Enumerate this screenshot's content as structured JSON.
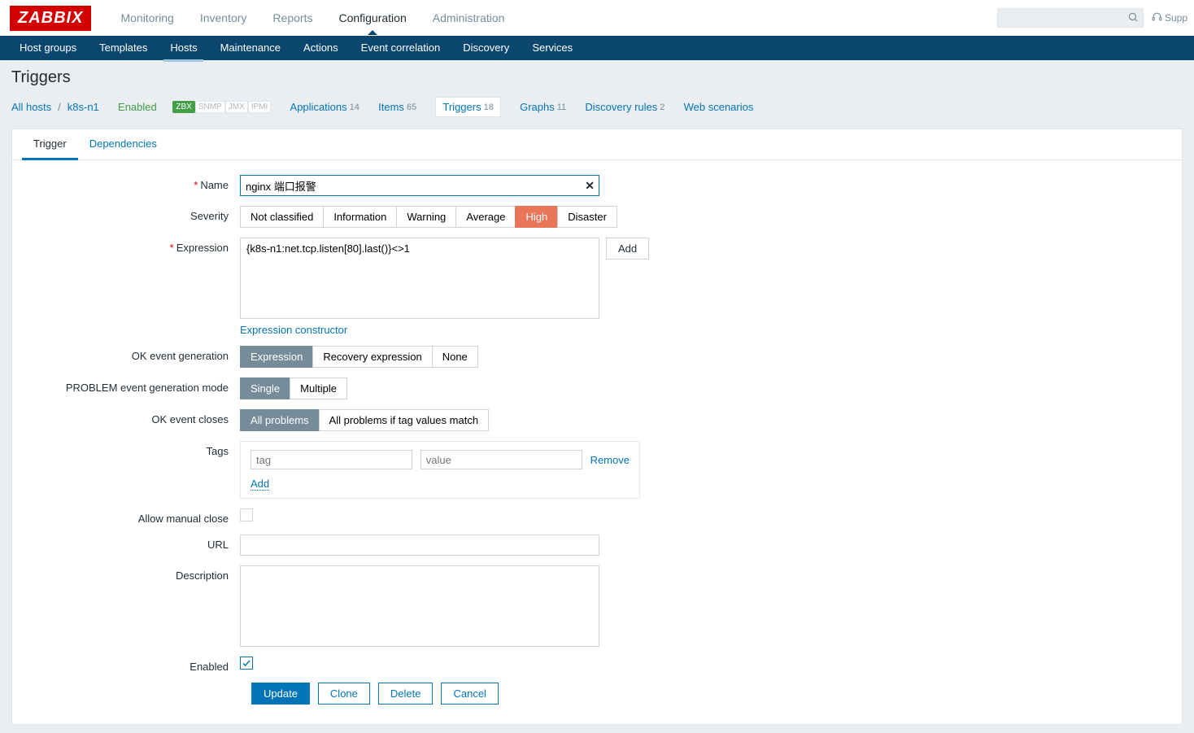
{
  "logo": "ZABBIX",
  "topnav": {
    "monitoring": "Monitoring",
    "inventory": "Inventory",
    "reports": "Reports",
    "configuration": "Configuration",
    "administration": "Administration"
  },
  "topright": {
    "support": "Supp"
  },
  "subnav": {
    "host_groups": "Host groups",
    "templates": "Templates",
    "hosts": "Hosts",
    "maintenance": "Maintenance",
    "actions": "Actions",
    "event_correlation": "Event correlation",
    "discovery": "Discovery",
    "services": "Services"
  },
  "page": {
    "title": "Triggers"
  },
  "breadcrumb": {
    "all_hosts": "All hosts",
    "host": "k8s-n1",
    "enabled": "Enabled",
    "zbx": "ZBX",
    "snmp": "SNMP",
    "jmx": "JMX",
    "ipmi": "IPMI",
    "apps": "Applications",
    "apps_count": "14",
    "items": "Items",
    "items_count": "65",
    "triggers": "Triggers",
    "triggers_count": "18",
    "graphs": "Graphs",
    "graphs_count": "11",
    "discovery": "Discovery rules",
    "discovery_count": "2",
    "web": "Web scenarios"
  },
  "tabs": {
    "trigger": "Trigger",
    "dependencies": "Dependencies"
  },
  "form": {
    "name_label": "Name",
    "name_value": "nginx 端口报警",
    "severity_label": "Severity",
    "severity": {
      "not_classified": "Not classified",
      "information": "Information",
      "warning": "Warning",
      "average": "Average",
      "high": "High",
      "disaster": "Disaster"
    },
    "expression_label": "Expression",
    "expression_value": "{k8s-n1:net.tcp.listen[80].last()}<>1",
    "add_btn": "Add",
    "expression_constructor": "Expression constructor",
    "ok_event_gen_label": "OK event generation",
    "ok_event_gen": {
      "expression": "Expression",
      "recovery": "Recovery expression",
      "none": "None"
    },
    "problem_mode_label": "PROBLEM event generation mode",
    "problem_mode": {
      "single": "Single",
      "multiple": "Multiple"
    },
    "ok_closes_label": "OK event closes",
    "ok_closes": {
      "all": "All problems",
      "match": "All problems if tag values match"
    },
    "tags_label": "Tags",
    "tag_placeholder": "tag",
    "value_placeholder": "value",
    "remove": "Remove",
    "add_link": "Add",
    "allow_manual_label": "Allow manual close",
    "url_label": "URL",
    "description_label": "Description",
    "enabled_label": "Enabled",
    "buttons": {
      "update": "Update",
      "clone": "Clone",
      "delete": "Delete",
      "cancel": "Cancel"
    }
  }
}
